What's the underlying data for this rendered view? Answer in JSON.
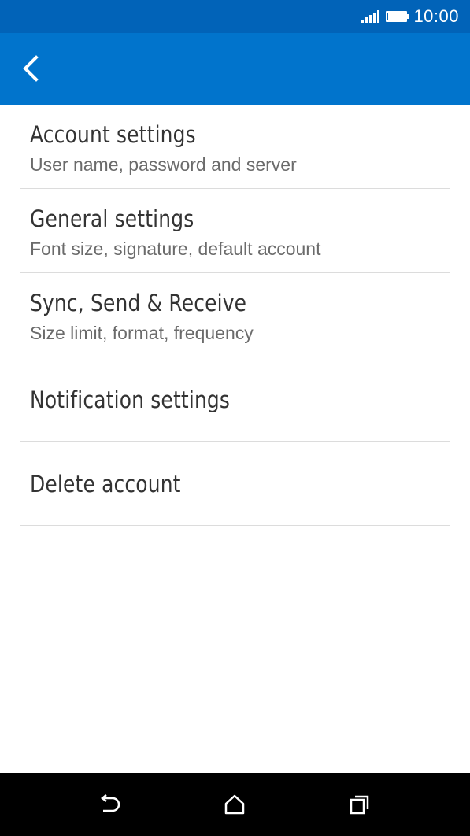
{
  "status_bar": {
    "time": "10:00",
    "icons": [
      "signal-icon",
      "battery-icon"
    ]
  },
  "app_bar": {
    "back_icon": "back-arrow-icon"
  },
  "settings": [
    {
      "title": "Account settings",
      "subtitle": "User name, password and server"
    },
    {
      "title": "General settings",
      "subtitle": "Font size, signature, default account"
    },
    {
      "title": "Sync, Send & Receive",
      "subtitle": "Size limit, format, frequency"
    },
    {
      "title": "Notification settings"
    },
    {
      "title": "Delete account"
    }
  ],
  "nav_bar": {
    "icons": [
      "nav-back-icon",
      "nav-home-icon",
      "nav-recents-icon"
    ]
  },
  "colors": {
    "status_bar": "#0163b8",
    "app_bar": "#0174cc",
    "divider": "#dcdcdc",
    "title_text": "#333333",
    "subtitle_text": "#6b6b6b"
  }
}
